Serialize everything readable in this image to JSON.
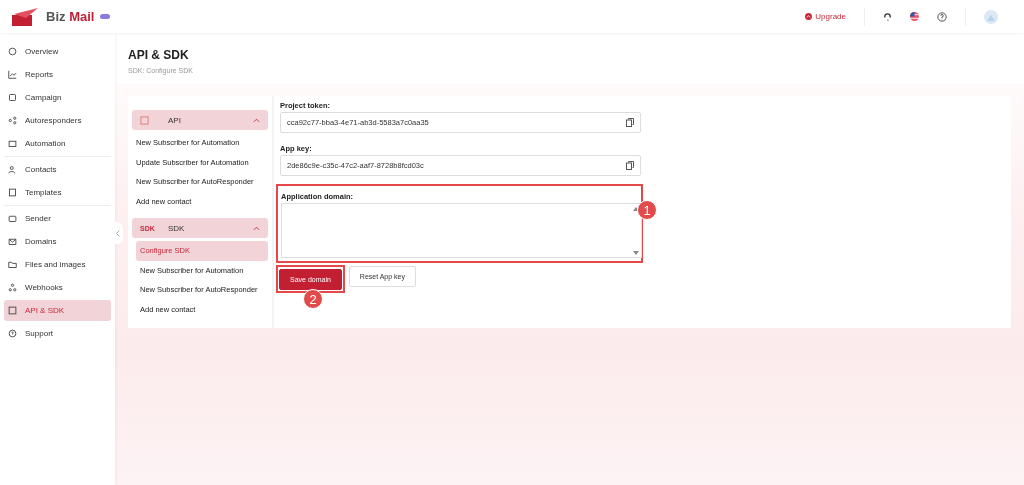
{
  "header": {
    "brand_first": "Biz",
    "brand_second": "Mail",
    "upgrade": "Upgrade"
  },
  "sidebar": {
    "groups": [
      [
        {
          "label": "Overview",
          "selected": false
        },
        {
          "label": "Reports",
          "selected": false
        },
        {
          "label": "Campaign",
          "selected": false
        },
        {
          "label": "Autoresponders",
          "selected": false
        },
        {
          "label": "Automation",
          "selected": false
        }
      ],
      [
        {
          "label": "Contacts",
          "selected": false
        },
        {
          "label": "Templates",
          "selected": false
        }
      ],
      [
        {
          "label": "Sender",
          "selected": false
        },
        {
          "label": "Domains",
          "selected": false
        },
        {
          "label": "Files and images",
          "selected": false
        },
        {
          "label": "Webhooks",
          "selected": false
        },
        {
          "label": "API & SDK",
          "selected": true
        },
        {
          "label": "Support",
          "selected": false
        }
      ]
    ]
  },
  "page": {
    "title": "API & SDK",
    "breadcrumb": "SDK: Configure SDK"
  },
  "menu": {
    "sections": [
      {
        "label": "API",
        "expanded": true,
        "items": [
          {
            "label": "New Subscriber for Automation",
            "selected": false
          },
          {
            "label": "Update Subscriber for Automation",
            "selected": false
          },
          {
            "label": "New Subscriber for AutoResponder",
            "selected": false
          },
          {
            "label": "Add new contact",
            "selected": false
          }
        ]
      },
      {
        "label": "SDK",
        "icon_text": "SDK",
        "expanded": true,
        "items": [
          {
            "label": "Configure SDK",
            "selected": true
          },
          {
            "label": "New Subscriber for Automation",
            "selected": false
          },
          {
            "label": "New Subscriber for AutoResponder",
            "selected": false
          },
          {
            "label": "Add new contact",
            "selected": false
          }
        ]
      }
    ]
  },
  "form": {
    "fields": [
      {
        "kind": "copy",
        "label": "Project token:",
        "value": "cca92c77-bba3-4e71-ab3d-5583a7c0aa35"
      },
      {
        "kind": "copy",
        "label": "App key:",
        "value": "2de86c9e-c35c-47c2-aaf7-8728b8fcd03c"
      },
      {
        "kind": "textarea",
        "label": "Application domain:",
        "callout": "1"
      }
    ],
    "buttons": [
      {
        "kind": "primary",
        "label": "Save domain",
        "callout": "2"
      },
      {
        "kind": "secondary",
        "label": "Reset App key"
      }
    ]
  }
}
